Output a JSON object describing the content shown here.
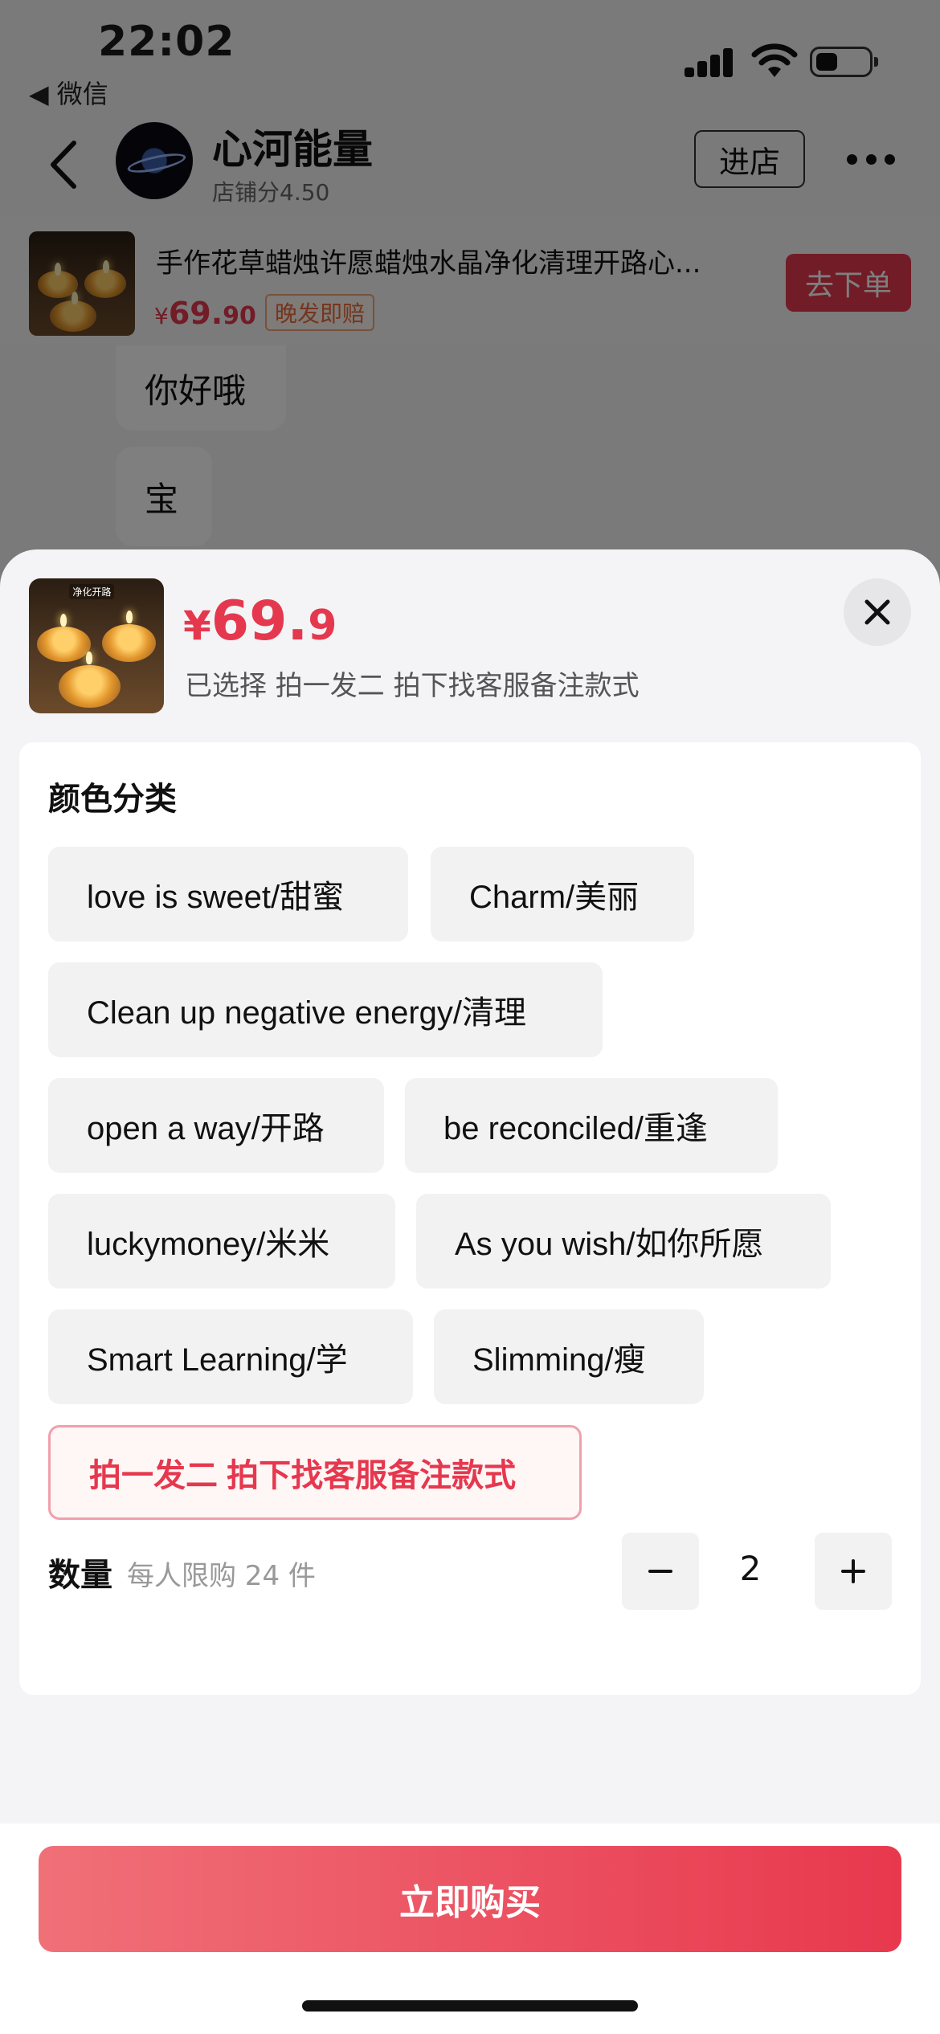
{
  "status_bar": {
    "time": "22:02",
    "back_app_label": "◀ 微信"
  },
  "header": {
    "shop_name": "心河能量",
    "shop_score": "店铺分4.50",
    "enter_shop_label": "进店"
  },
  "product_card": {
    "title": "手作花草蜡烛许愿蜡烛水晶净化清理开路心...",
    "price_symbol": "¥",
    "price_int": "69.",
    "price_dec": "90",
    "badge": "晚发即赔",
    "order_label": "去下单",
    "thumb_caption": "净化开路"
  },
  "chat": {
    "messages": [
      "你好哦",
      "宝"
    ]
  },
  "sheet": {
    "price_symbol": "¥",
    "price_int": "69.",
    "price_dec": "9",
    "selected_text": "已选择 拍一发二 拍下找客服备注款式",
    "section_title": "颜色分类",
    "options": [
      {
        "label": "love is sweet/甜蜜",
        "selected": false
      },
      {
        "label": "Charm/美丽",
        "selected": false
      },
      {
        "label": "Clean up negative energy/清理",
        "selected": false
      },
      {
        "label": "open a way/开路",
        "selected": false
      },
      {
        "label": "be reconciled/重逢",
        "selected": false
      },
      {
        "label": "luckymoney/米米",
        "selected": false
      },
      {
        "label": "As you wish/如你所愿",
        "selected": false
      },
      {
        "label": "Smart Learning/学",
        "selected": false
      },
      {
        "label": "Slimming/瘦",
        "selected": false
      },
      {
        "label": "拍一发二 拍下找客服备注款式",
        "selected": true
      }
    ],
    "quantity_label": "数量",
    "quantity_limit": "每人限购 24 件",
    "quantity_value": "2",
    "buy_label": "立即购买"
  },
  "colors": {
    "accent": "#e5384e",
    "overlay": "rgba(0,0,0,0.5)"
  }
}
